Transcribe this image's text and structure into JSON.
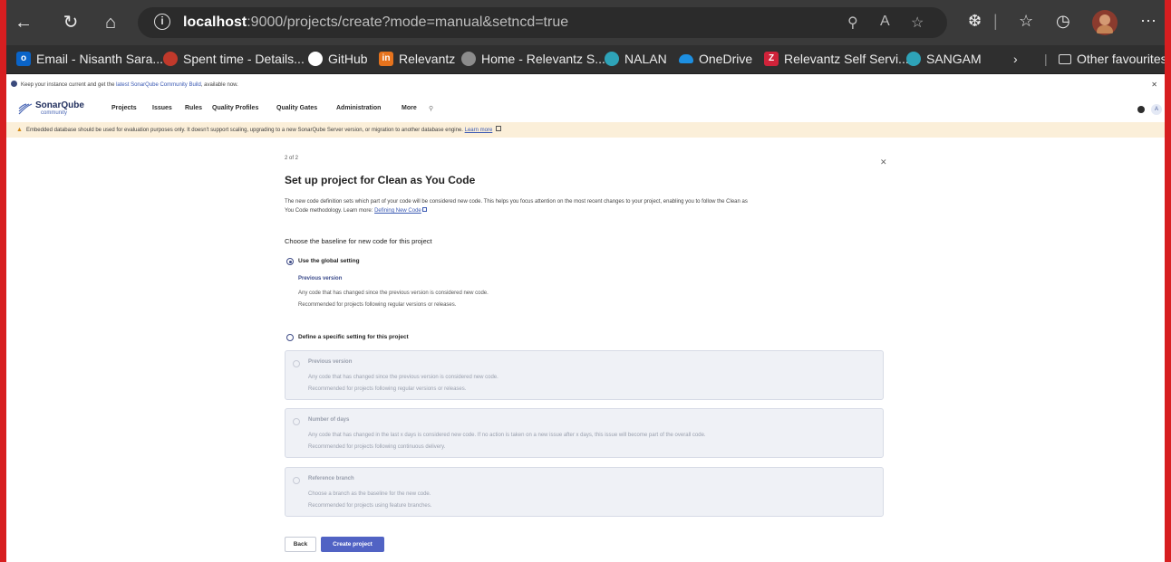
{
  "browser": {
    "url_host": "localhost",
    "url_path": ":9000/projects/create?mode=manual&setncd=true",
    "favorites": [
      {
        "label": "Email - Nisanth Sara...",
        "icon": "outlook-icon",
        "color": "#0a64c8"
      },
      {
        "label": "Spent time - Details...",
        "icon": "redmine-icon",
        "color": "#c0392b"
      },
      {
        "label": "GitHub",
        "icon": "github-icon",
        "color": "#ffffff"
      },
      {
        "label": "Relevantz",
        "icon": "relevantz-icon",
        "color": "#e6731d"
      },
      {
        "label": "Home - Relevantz S...",
        "icon": "home-site-icon",
        "color": "#8c8c8c"
      },
      {
        "label": "NALAN",
        "icon": "nalan-icon",
        "color": "#2ea3b8"
      },
      {
        "label": "OneDrive",
        "icon": "onedrive-icon",
        "color": "#1d8fe1"
      },
      {
        "label": "Relevantz Self Servi...",
        "icon": "zoho-icon",
        "color": "#d0233a"
      },
      {
        "label": "SANGAM",
        "icon": "sangam-icon",
        "color": "#2ea3b8"
      }
    ],
    "other_favourites": "Other favourites"
  },
  "notice": {
    "text_before": "Keep your instance current and get the ",
    "link": "latest SonarQube Community Build",
    "text_after": ", available now."
  },
  "sonar_nav": {
    "logo_word": "SonarQube",
    "logo_sub": "community",
    "items": [
      "Projects",
      "Issues",
      "Rules",
      "Quality Profiles",
      "Quality Gates",
      "Administration",
      "More"
    ],
    "account_initial": "A"
  },
  "warning": {
    "text": "Embedded database should be used for evaluation purposes only. It doesn't support scaling, upgrading to a new SonarQube Server version, or migration to another database engine.",
    "link": "Learn more"
  },
  "form": {
    "step": "2 of 2",
    "title": "Set up project for Clean as You Code",
    "desc_line1": "The new code definition sets which part of your code will be considered new code. This helps you focus attention on the most recent changes to your project, enabling you to follow the Clean as",
    "desc_line2": "You Code methodology. Learn more: ",
    "desc_link": "Defining New Code",
    "choose_label": "Choose the baseline for new code for this project",
    "global_option": {
      "label": "Use the global setting",
      "selected": true,
      "sub_title": "Previous version",
      "line1": "Any code that has changed since the previous version is considered new code.",
      "line2": "Recommended for projects following regular versions or releases."
    },
    "specific_option": {
      "label": "Define a specific setting for this project",
      "selected": false
    },
    "cards": [
      {
        "title": "Previous version",
        "line1": "Any code that has changed since the previous version is considered new code.",
        "line2": "Recommended for projects following regular versions or releases."
      },
      {
        "title": "Number of days",
        "line1": "Any code that has changed in the last x days is considered new code. If no action is taken on a new issue after x days, this issue will become part of the overall code.",
        "line2": "Recommended for projects following continuous delivery."
      },
      {
        "title": "Reference branch",
        "line1": "Choose a branch as the baseline for the new code.",
        "line2": "Recommended for projects using feature branches."
      }
    ],
    "back_label": "Back",
    "create_label": "Create project"
  }
}
